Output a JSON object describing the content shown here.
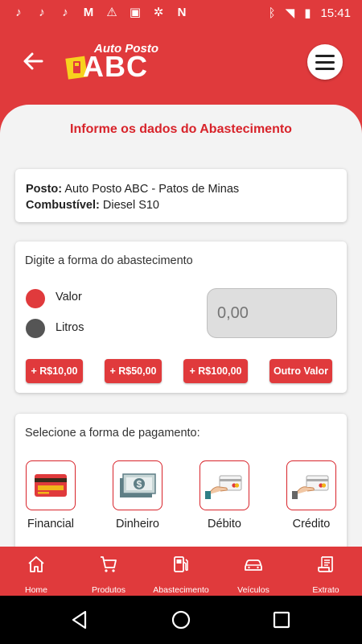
{
  "status_bar": {
    "time": "15:41"
  },
  "header": {
    "logo_top": "Auto Posto",
    "logo_main": "ABC"
  },
  "page_title": "Informe os dados do Abastecimento",
  "info_card": {
    "posto_label": "Posto:",
    "posto_value": "Auto Posto ABC - Patos de Minas",
    "combustivel_label": "Combustível:",
    "combustivel_value": "Diesel S10"
  },
  "fill_card": {
    "title": "Digite a forma do abastecimento",
    "options": [
      {
        "label": "Valor",
        "selected": true
      },
      {
        "label": "Litros",
        "selected": false
      }
    ],
    "amount_placeholder": "0,00",
    "quick_buttons": [
      "+ R$10,00",
      "+ R$50,00",
      "+ R$100,00",
      "Outro Valor"
    ]
  },
  "payment_card": {
    "title": "Selecione a forma de pagamento:",
    "methods": [
      {
        "label": "Financial",
        "icon": "credit-card-icon"
      },
      {
        "label": "Dinheiro",
        "icon": "cash-icon"
      },
      {
        "label": "Débito",
        "icon": "card-in-hand-icon"
      },
      {
        "label": "Crédito",
        "icon": "card-in-hand-icon"
      }
    ]
  },
  "bottom_nav": [
    {
      "label": "Home",
      "icon": "home-icon"
    },
    {
      "label": "Produtos",
      "icon": "cart-icon"
    },
    {
      "label": "Abastecimento",
      "icon": "fuel-pump-icon"
    },
    {
      "label": "Veículos",
      "icon": "car-icon"
    },
    {
      "label": "Extrato",
      "icon": "receipt-icon"
    }
  ],
  "colors": {
    "primary": "#e03a3c",
    "title_red": "#d8232a",
    "background": "#f3f3f3"
  }
}
